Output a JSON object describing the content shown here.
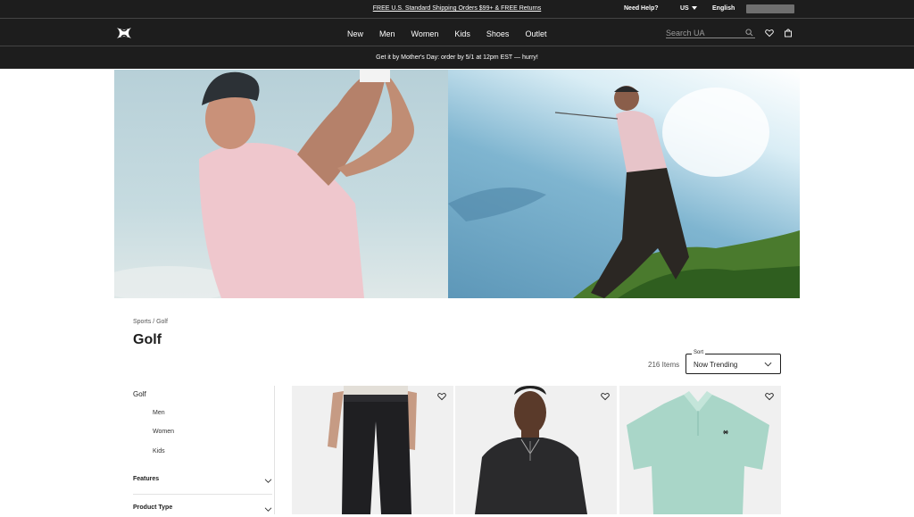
{
  "utility_bar": {
    "promo": "FREE U.S. Standard Shipping Orders $99+ & FREE Returns",
    "need_help": "Need Help?",
    "country": "US",
    "language": "English"
  },
  "nav": {
    "items": [
      "New",
      "Men",
      "Women",
      "Kids",
      "Shoes",
      "Outlet"
    ],
    "search_placeholder": "Search UA"
  },
  "announcement": "Get it by Mother's Day: order by 5/1 at 12pm EST — hurry!",
  "breadcrumb": {
    "parent": "Sports",
    "separator": "/",
    "current": "Golf"
  },
  "page_title": "Golf",
  "results": {
    "count": "216",
    "count_label": "Items"
  },
  "sort": {
    "label": "Sort",
    "value": "Now Trending"
  },
  "sidebar": {
    "category": "Golf",
    "subcategories": [
      "Men",
      "Women",
      "Kids"
    ],
    "facets": [
      "Features",
      "Product Type"
    ]
  },
  "products": [
    {
      "name": "golf-pants",
      "color": "#1f1f22"
    },
    {
      "name": "black-polo",
      "color": "#2a2a2c"
    },
    {
      "name": "mint-polo",
      "color": "#a9d6c8"
    }
  ],
  "colors": {
    "dark_bar": "#1d1d1d",
    "tile_bg": "#f0f0f0"
  }
}
